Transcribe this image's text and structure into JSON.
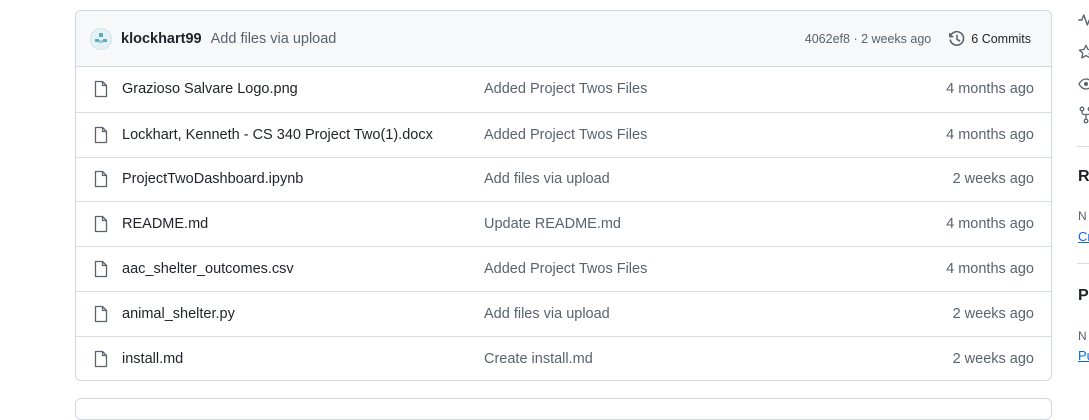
{
  "commit": {
    "author": "klockhart99",
    "message": "Add files via upload",
    "meta": "4062ef8 · 2 weeks ago",
    "commits_label": "6 Commits"
  },
  "files": [
    {
      "name": "Grazioso Salvare Logo.png",
      "message": "Added Project Twos Files",
      "date": "4 months ago"
    },
    {
      "name": "Lockhart, Kenneth - CS 340 Project Two(1).docx",
      "message": "Added Project Twos Files",
      "date": "4 months ago"
    },
    {
      "name": "ProjectTwoDashboard.ipynb",
      "message": "Add files via upload",
      "date": "2 weeks ago"
    },
    {
      "name": "README.md",
      "message": "Update README.md",
      "date": "4 months ago"
    },
    {
      "name": "aac_shelter_outcomes.csv",
      "message": "Added Project Twos Files",
      "date": "4 months ago"
    },
    {
      "name": "animal_shelter.py",
      "message": "Add files via upload",
      "date": "2 weeks ago"
    },
    {
      "name": "install.md",
      "message": "Create install.md",
      "date": "2 weeks ago"
    }
  ],
  "sidebar": {
    "releases_heading": "R",
    "releases_note": "N",
    "releases_link": "Cr",
    "packages_heading": "Pa",
    "packages_note": "N",
    "packages_link": "Pu"
  },
  "icons": {
    "file": "file-icon",
    "history": "history-icon",
    "activity": "pulse-icon",
    "star": "star-icon",
    "watch": "eye-icon",
    "fork": "fork-icon"
  }
}
